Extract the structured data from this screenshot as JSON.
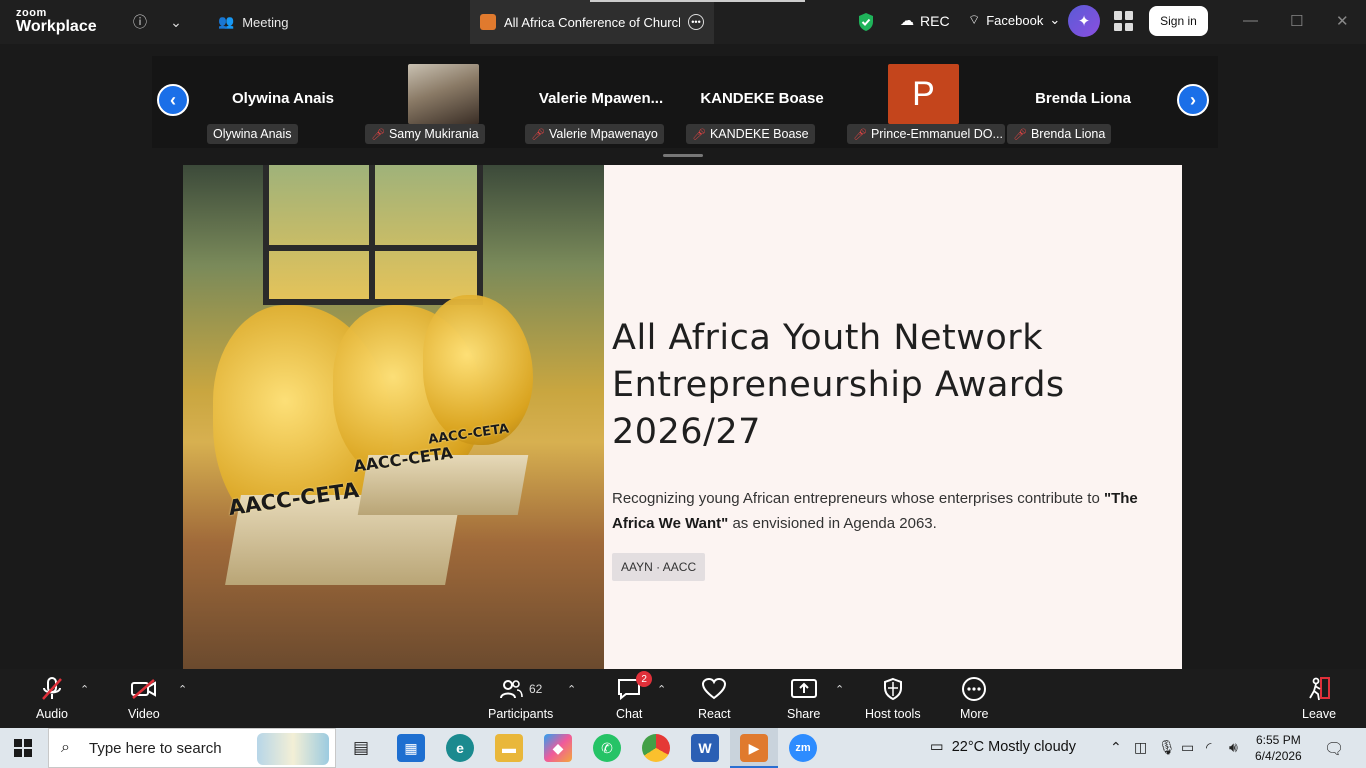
{
  "app": {
    "brand_small": "zoom",
    "brand_big": "Workplace"
  },
  "topbar": {
    "meeting_label": "Meeting",
    "tab_title": "All Africa Conference of Churches",
    "rec_label": "REC",
    "stream_label": "Facebook",
    "signin_label": "Sign in"
  },
  "participants_strip": [
    {
      "display": "Olywina Anais",
      "label": "Olywina Anais",
      "muted": false
    },
    {
      "display": "",
      "label": "Samy Mukirania",
      "muted": true
    },
    {
      "display": "Valerie  Mpawen...",
      "label": "Valerie Mpawenayo",
      "muted": true
    },
    {
      "display": "KANDEKE Boase",
      "label": "KANDEKE Boase",
      "muted": true
    },
    {
      "display": "P",
      "label": "Prince-Emmanuel DO...",
      "muted": true
    },
    {
      "display": "Brenda Liona",
      "label": "Brenda Liona",
      "muted": true
    }
  ],
  "slide": {
    "title_line1": "All Africa Youth Network",
    "title_line2": "Entrepreneurship Awards",
    "title_line3": "2026/27",
    "body_pre": "Recognizing young African entrepreneurs whose enterprises contribute to ",
    "body_bold": "\"The Africa We Want\"",
    "body_post": " as envisioned in Agenda 2063.",
    "tag": "AAYN · AACC",
    "photo_plaques": [
      "AACC-CETA",
      "AACC-CETA",
      "AACC-CETA"
    ]
  },
  "toolbar": {
    "audio": "Audio",
    "video": "Video",
    "participants": "Participants",
    "participants_count": "62",
    "chat": "Chat",
    "chat_badge": "2",
    "react": "React",
    "share": "Share",
    "host_tools": "Host tools",
    "more": "More",
    "leave": "Leave"
  },
  "taskbar": {
    "search_placeholder": "Type here to search",
    "weather": "22°C  Mostly cloudy",
    "time": "6:55 PM",
    "date": "6/4/2026"
  },
  "colors": {
    "accent_blue": "#1a6fe8",
    "ppt_orange": "#c4451c",
    "badge_red": "#e0303a"
  }
}
